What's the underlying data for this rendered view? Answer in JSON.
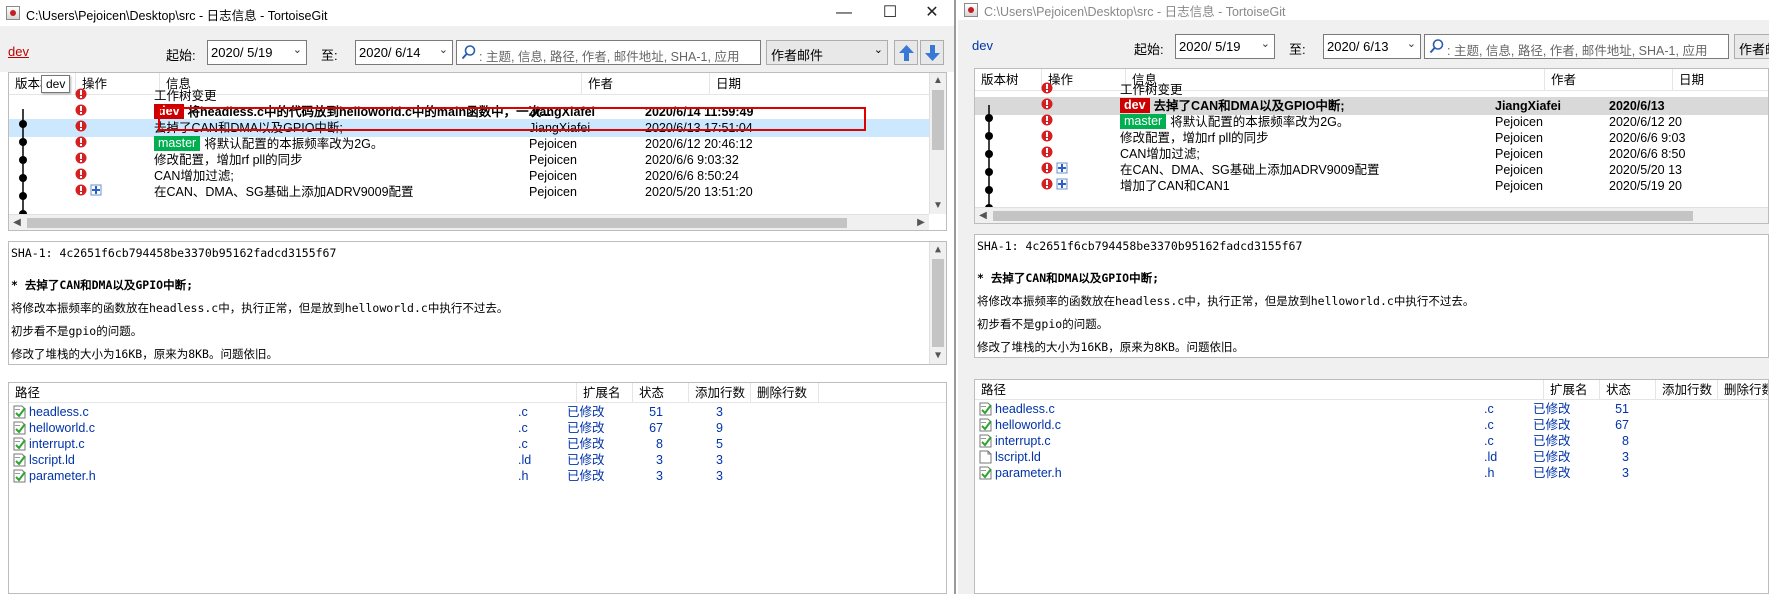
{
  "left": {
    "title": "C:\\Users\\Pejoicen\\Desktop\\src - 日志信息 - TortoiseGit",
    "branch_link": "dev",
    "from_label": "起始:",
    "from_date": "2020/ 5/19",
    "to_label": "至:",
    "to_date": "2020/ 6/14",
    "search_placeholder": ": 主题, 信息, 路径, 作者, 邮件地址, SHA-1, 应用",
    "filter_combo": "作者邮件",
    "tooltip": "dev",
    "columns": [
      "版本树",
      "操作",
      "信息",
      "作者",
      "日期"
    ],
    "rows": [
      {
        "tag": "",
        "tag_color": "",
        "msg": "工作树变更",
        "author": "",
        "date": "",
        "icons": 1
      },
      {
        "tag": "dev",
        "tag_color": "red",
        "msg": "将headless.c中的代码放到helloworld.c中的main函数中，一次...",
        "author": "JiangXiafei",
        "date": "2020/6/14 11:59:49",
        "icons": 1
      },
      {
        "tag": "",
        "tag_color": "",
        "msg": "去掉了CAN和DMA以及GPIO中断;",
        "author": "JiangXiafei",
        "date": "2020/6/13 17:51:04",
        "icons": 1
      },
      {
        "tag": "master",
        "tag_color": "green",
        "msg": "将默认配置的本振频率改为2G。",
        "author": "Pejoicen",
        "date": "2020/6/12 20:46:12",
        "icons": 1
      },
      {
        "tag": "",
        "tag_color": "",
        "msg": "修改配置，增加rf pll的同步",
        "author": "Pejoicen",
        "date": "2020/6/6 9:03:32",
        "icons": 1
      },
      {
        "tag": "",
        "tag_color": "",
        "msg": "CAN增加过滤;",
        "author": "Pejoicen",
        "date": "2020/6/6 8:50:24",
        "icons": 1
      },
      {
        "tag": "",
        "tag_color": "",
        "msg": "在CAN、DMA、SG基础上添加ADRV9009配置",
        "author": "Pejoicen",
        "date": "2020/5/20 13:51:20",
        "icons": 2
      }
    ],
    "sha": "SHA-1: 4c2651f6cb794458be3370b95162fadcd3155f67",
    "message_lines": [
      "* 去掉了CAN和DMA以及GPIO中断;",
      "将修改本振频率的函数放在headless.c中，执行正常，但是放到helloworld.c中执行不过去。",
      "初步看不是gpio的问题。",
      "修改了堆栈的大小为16KB，原来为8KB。问题依旧。"
    ],
    "file_columns": [
      "路径",
      "扩展名",
      "状态",
      "添加行数",
      "删除行数"
    ],
    "files": [
      {
        "path": "headless.c",
        "ext": ".c",
        "status": "已修改",
        "added": "51",
        "deleted": "3"
      },
      {
        "path": "helloworld.c",
        "ext": ".c",
        "status": "已修改",
        "added": "67",
        "deleted": "9"
      },
      {
        "path": "interrupt.c",
        "ext": ".c",
        "status": "已修改",
        "added": "8",
        "deleted": "5"
      },
      {
        "path": "lscript.ld",
        "ext": ".ld",
        "status": "已修改",
        "added": "3",
        "deleted": "3"
      },
      {
        "path": "parameter.h",
        "ext": ".h",
        "status": "已修改",
        "added": "3",
        "deleted": "3"
      }
    ]
  },
  "right": {
    "title": "C:\\Users\\Pejoicen\\Desktop\\src - 日志信息 - TortoiseGit",
    "branch_link": "dev",
    "from_label": "起始:",
    "from_date": "2020/ 5/19",
    "to_label": "至:",
    "to_date": "2020/ 6/13",
    "search_placeholder": ": 主题, 信息, 路径, 作者, 邮件地址, SHA-1, 应用",
    "filter_combo": "作者邮",
    "columns": [
      "版本树",
      "操作",
      "信息",
      "作者",
      "日期"
    ],
    "rows": [
      {
        "tag": "",
        "tag_color": "",
        "msg": "工作树变更",
        "author": "",
        "date": "",
        "icons": 1
      },
      {
        "tag": "dev",
        "tag_color": "red",
        "msg": "去掉了CAN和DMA以及GPIO中断;",
        "author": "JiangXiafei",
        "date": "2020/6/13",
        "icons": 1
      },
      {
        "tag": "master",
        "tag_color": "green",
        "msg": "将默认配置的本振频率改为2G。",
        "author": "Pejoicen",
        "date": "2020/6/12 20",
        "icons": 1
      },
      {
        "tag": "",
        "tag_color": "",
        "msg": "修改配置，增加rf pll的同步",
        "author": "Pejoicen",
        "date": "2020/6/6 9:03",
        "icons": 1
      },
      {
        "tag": "",
        "tag_color": "",
        "msg": "CAN增加过滤;",
        "author": "Pejoicen",
        "date": "2020/6/6 8:50",
        "icons": 1
      },
      {
        "tag": "",
        "tag_color": "",
        "msg": "在CAN、DMA、SG基础上添加ADRV9009配置",
        "author": "Pejoicen",
        "date": "2020/5/20 13",
        "icons": 2
      },
      {
        "tag": "",
        "tag_color": "",
        "msg": "增加了CAN和CAN1",
        "author": "Pejoicen",
        "date": "2020/5/19 20",
        "icons": 2
      }
    ],
    "sha": "SHA-1: 4c2651f6cb794458be3370b95162fadcd3155f67",
    "message_lines": [
      "* 去掉了CAN和DMA以及GPIO中断;",
      "将修改本振频率的函数放在headless.c中，执行正常，但是放到helloworld.c中执行不过去。",
      "初步看不是gpio的问题。",
      "修改了堆栈的大小为16KB，原来为8KB。问题依旧。"
    ],
    "file_columns": [
      "路径",
      "扩展名",
      "状态",
      "添加行数",
      "删除行数"
    ],
    "files": [
      {
        "path": "headless.c",
        "ext": ".c",
        "status": "已修改",
        "added": "51"
      },
      {
        "path": "helloworld.c",
        "ext": ".c",
        "status": "已修改",
        "added": "67"
      },
      {
        "path": "interrupt.c",
        "ext": ".c",
        "status": "已修改",
        "added": "8"
      },
      {
        "path": "lscript.ld",
        "ext": ".ld",
        "status": "已修改",
        "added": "3"
      },
      {
        "path": "parameter.h",
        "ext": ".h",
        "status": "已修改",
        "added": "3"
      }
    ]
  },
  "icons": {
    "minimize": "—",
    "maximize": "☐",
    "close": "✕",
    "chevron_down": "⌄",
    "scroll_up": "▲",
    "scroll_down": "▼",
    "scroll_left": "◀",
    "scroll_right": "▶"
  },
  "colors": {
    "branch_link": "#c00000",
    "right_branch_link": "#0033aa",
    "tag_red": "#cc0000",
    "tag_green": "#00b050",
    "highlight_box": "#e00000",
    "selection_blue": "#cce8ff"
  }
}
